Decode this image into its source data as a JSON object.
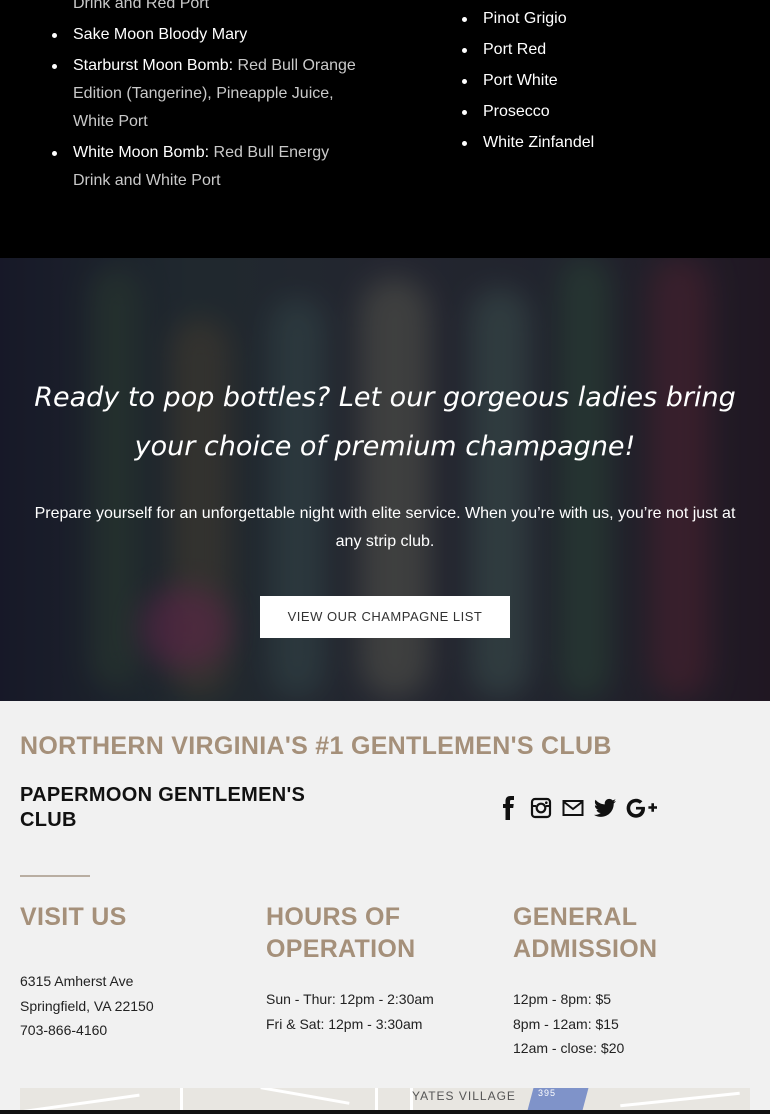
{
  "drinks": {
    "left": [
      {
        "name": "",
        "desc": "Drink and Red Port",
        "continued": true
      },
      {
        "name": "Sake Moon Bloody Mary",
        "desc": ""
      },
      {
        "name": "Starburst Moon Bomb:",
        "desc": "Red Bull Orange Edition (Tangerine), Pineapple Juice, White Port"
      },
      {
        "name": "White Moon Bomb:",
        "desc": "Red Bull Energy Drink and White Port"
      }
    ],
    "right": [
      "Pinot Grigio",
      "Port Red",
      "Port White",
      "Prosecco",
      "White Zinfandel"
    ]
  },
  "hero": {
    "title": "Ready to pop bottles? Let our gorgeous ladies bring your choice of premium champagne!",
    "text": "Prepare yourself for an unforgettable night with elite service. When you’re with us, you’re not just at any strip club.",
    "button": "VIEW OUR CHAMPAGNE LIST"
  },
  "footer": {
    "tagline": "NORTHERN VIRGINIA'S #1 GENTLEMEN'S CLUB",
    "club_name": "PAPERMOON GENTLEMEN'S CLUB",
    "social_icons": [
      "facebook-icon",
      "instagram-icon",
      "mail-icon",
      "twitter-icon",
      "google-plus-icon"
    ],
    "visit": {
      "heading": "VISIT US",
      "lines": [
        "6315 Amherst Ave",
        "Springfield, VA 22150",
        "703-866-4160"
      ]
    },
    "hours": {
      "heading": "HOURS OF OPERATION",
      "lines": [
        "Sun - Thur: 12pm - 2:30am",
        "Fri & Sat: 12pm - 3:30am"
      ]
    },
    "admission": {
      "heading": "GENERAL ADMISSION",
      "lines": [
        "12pm - 8pm: $5",
        "8pm - 12am: $15",
        "12am - close: $20"
      ]
    },
    "map": {
      "label": "YATES VILLAGE",
      "shield": "395"
    }
  },
  "colors": {
    "accent": "#a5907a",
    "footer_bg": "#f1f1f1",
    "hero_overlay": "#14142380"
  }
}
